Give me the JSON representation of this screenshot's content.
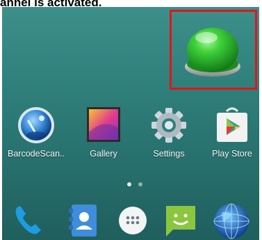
{
  "caption": "annel is activated.",
  "colors": {
    "highlight_border": "#e4141b",
    "green_button": "#27c22a",
    "wallpaper": "#2f7f7b"
  },
  "home": {
    "apps": [
      {
        "label": "BarcodeScan..",
        "icon": "barcode-scanner-icon"
      },
      {
        "label": "Gallery",
        "icon": "gallery-icon"
      },
      {
        "label": "Settings",
        "icon": "settings-gear-icon"
      },
      {
        "label": "Play Store",
        "icon": "play-store-icon"
      }
    ],
    "page_indicator": {
      "pages": 2,
      "current": 1
    }
  },
  "dock": {
    "items": [
      {
        "icon": "phone-icon"
      },
      {
        "icon": "contacts-icon"
      },
      {
        "icon": "app-drawer-icon"
      },
      {
        "icon": "messaging-icon"
      },
      {
        "icon": "browser-globe-icon"
      }
    ]
  }
}
